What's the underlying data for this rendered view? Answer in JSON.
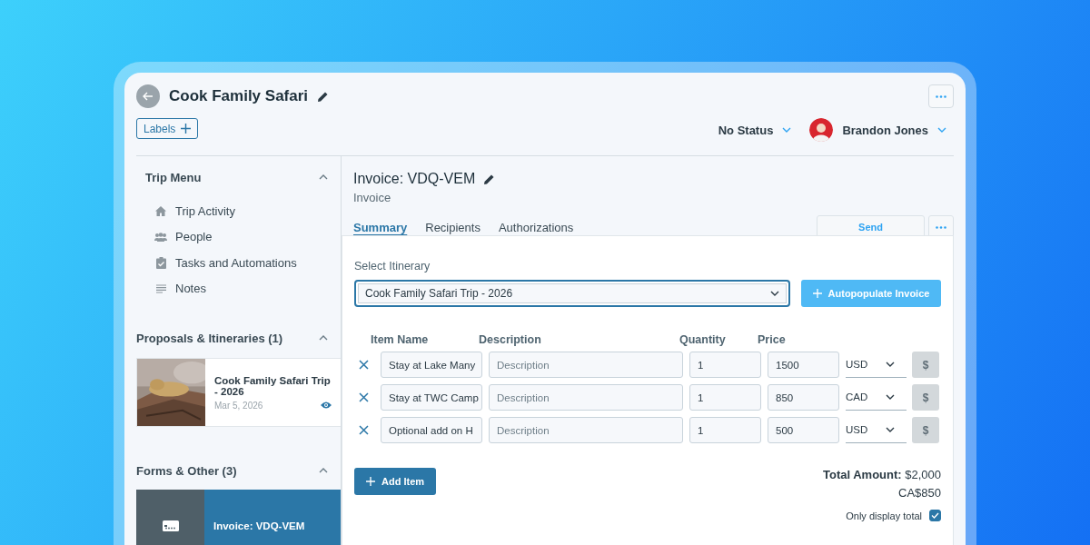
{
  "header": {
    "title": "Cook Family Safari",
    "labels_button": "Labels",
    "status": "No Status",
    "user": "Brandon Jones"
  },
  "sidebar": {
    "sections": [
      {
        "kind": "menu",
        "title": "Trip Menu",
        "expanded": true,
        "items": [
          {
            "label": "Trip Activity"
          },
          {
            "label": "People"
          },
          {
            "label": "Tasks and Automations"
          },
          {
            "label": "Notes"
          }
        ]
      },
      {
        "kind": "proposals",
        "title": "Proposals & Itineraries (1)",
        "expanded": true,
        "cards": [
          {
            "title": "Cook Family Safari Trip - 2026",
            "date": "Mar 5, 2026",
            "kind": "picture",
            "selected": false
          }
        ]
      },
      {
        "kind": "forms",
        "title": "Forms & Other (3)",
        "expanded": true,
        "cards": [
          {
            "title": "Invoice: VDQ-VEM",
            "kind": "document",
            "selected": true
          }
        ]
      }
    ]
  },
  "invoice": {
    "title": "Invoice: VDQ-VEM",
    "subtitle": "Invoice",
    "tabs": [
      {
        "label": "Summary",
        "selected": true
      },
      {
        "label": "Recipients",
        "selected": false
      },
      {
        "label": "Authorizations",
        "selected": false
      }
    ],
    "send_button": "Send",
    "itinerary_label": "Select Itinerary",
    "itinerary_value": "Cook Family Safari Trip - 2026",
    "autopopulate_button": "Autopopulate Invoice",
    "columns": [
      "Item Name",
      "Description",
      "Quantity",
      "Price"
    ],
    "rows": [
      {
        "item_name": "Stay at Lake Many",
        "description_placeholder": "Description",
        "quantity": "1",
        "price": "1500",
        "currency": "USD",
        "convert_button": "$",
        "convert_disabled": true
      },
      {
        "item_name": "Stay at TWC Camp",
        "description_placeholder": "Description",
        "quantity": "1",
        "price": "850",
        "currency": "CAD",
        "convert_button": "$",
        "convert_disabled": true
      },
      {
        "item_name": "Optional add on H",
        "description_placeholder": "Description",
        "quantity": "1",
        "price": "500",
        "currency": "USD",
        "convert_button": "$",
        "convert_disabled": true
      }
    ],
    "add_button": "Add Item",
    "totals": [
      "**Total Amount:** $2,000",
      "CA$850"
    ],
    "only_display_total": {
      "label": "Only display total",
      "checked": true
    }
  }
}
